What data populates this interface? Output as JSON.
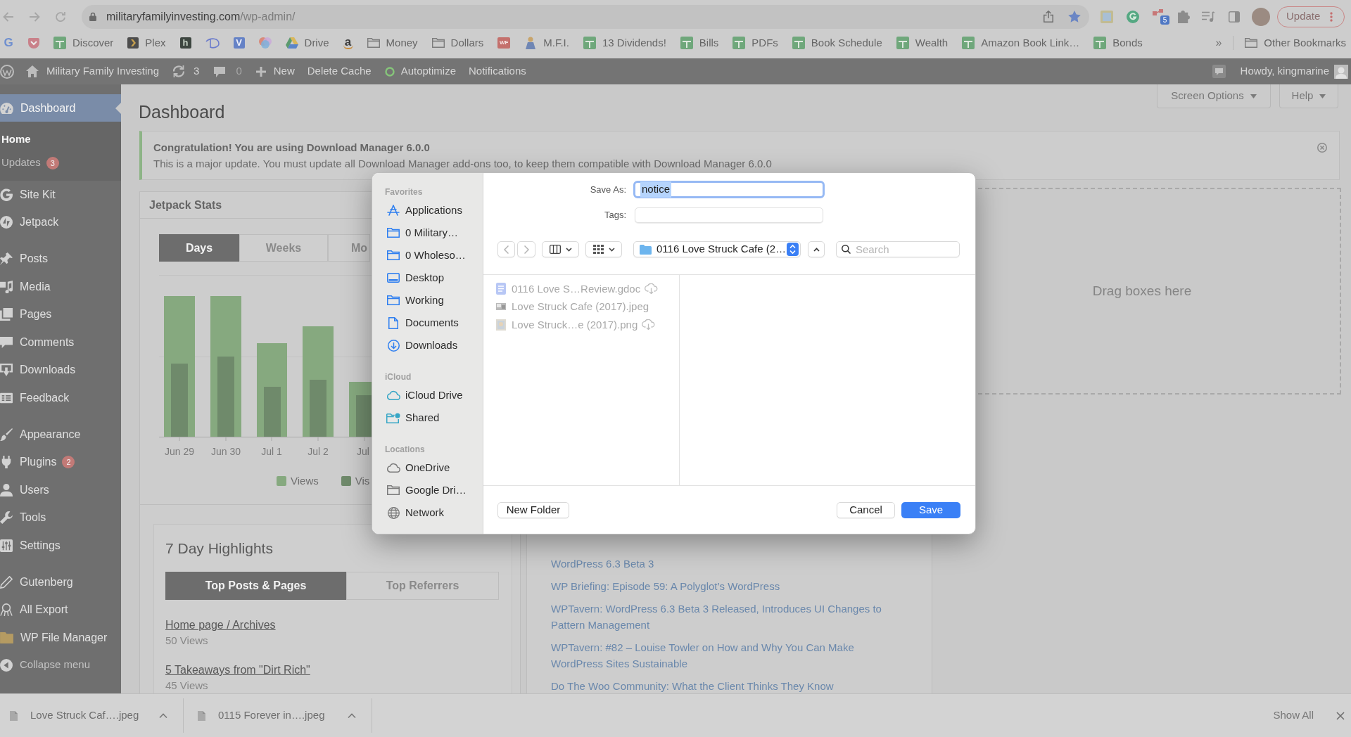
{
  "browser": {
    "url_host": "militaryfamilyinvesting.com",
    "url_path": "/wp-admin/",
    "extension_badge": "5",
    "update_button": "Update"
  },
  "bookmarks": [
    {
      "kind": "google",
      "glyph": "G"
    },
    {
      "kind": "pocket"
    },
    {
      "kind": "sheet",
      "label": "Discover"
    },
    {
      "kind": "plex",
      "label": "Plex"
    },
    {
      "kind": "tile",
      "glyph": "h"
    },
    {
      "kind": "swoosh"
    },
    {
      "kind": "tile_blue",
      "glyph": "V"
    },
    {
      "kind": "pinwheel"
    },
    {
      "kind": "drive",
      "label": "Drive"
    },
    {
      "kind": "amazon",
      "glyph": "a"
    },
    {
      "kind": "folder",
      "label": "Money"
    },
    {
      "kind": "folder",
      "label": "Dollars"
    },
    {
      "kind": "tile_red",
      "glyph": "WF"
    },
    {
      "kind": "figure",
      "label": "M.F.I."
    },
    {
      "kind": "sheet",
      "label": "13 Dividends!"
    },
    {
      "kind": "sheet",
      "label": "Bills"
    },
    {
      "kind": "sheet",
      "label": "PDFs"
    },
    {
      "kind": "sheet",
      "label": "Book Schedule"
    },
    {
      "kind": "sheet",
      "label": "Wealth"
    },
    {
      "kind": "sheet",
      "label": "Amazon Book Link…"
    },
    {
      "kind": "sheet",
      "label": "Bonds"
    }
  ],
  "bookmarks_overflow": "»",
  "other_bookmarks": "Other Bookmarks",
  "admin_bar": {
    "site_name": "Military Family Investing",
    "updates_count": "3",
    "comments_count": "0",
    "new_label": "New",
    "links": [
      {
        "label": "Delete Cache",
        "kind": "plain"
      },
      {
        "label": "Autoptimize",
        "kind": "status"
      },
      {
        "label": "Notifications",
        "kind": "plain"
      }
    ],
    "greeting": "Howdy, kingmarine"
  },
  "sidebar": {
    "groups": [
      {
        "items": [
          {
            "label": "Dashboard",
            "kind": "dashboard",
            "selected": true,
            "children": [
              {
                "label": "Home",
                "selected": true
              },
              {
                "label": "Updates",
                "selected": false,
                "badge": "3"
              }
            ]
          },
          {
            "label": "Site Kit",
            "kind": "sitekit",
            "selected": false
          },
          {
            "label": "Jetpack",
            "kind": "jetpack",
            "selected": false
          }
        ]
      },
      {
        "items": [
          {
            "label": "Posts",
            "kind": "posts",
            "selected": false
          },
          {
            "label": "Media",
            "kind": "media",
            "selected": false
          },
          {
            "label": "Pages",
            "kind": "pages",
            "selected": false
          },
          {
            "label": "Comments",
            "kind": "comments",
            "selected": false
          },
          {
            "label": "Downloads",
            "kind": "downloads",
            "selected": false
          },
          {
            "label": "Feedback",
            "kind": "feedback",
            "selected": false
          }
        ]
      },
      {
        "items": [
          {
            "label": "Appearance",
            "kind": "appearance",
            "selected": false
          },
          {
            "label": "Plugins",
            "kind": "plugins",
            "selected": false,
            "badge": "2"
          },
          {
            "label": "Users",
            "kind": "users",
            "selected": false
          },
          {
            "label": "Tools",
            "kind": "tools",
            "selected": false
          },
          {
            "label": "Settings",
            "kind": "settings",
            "selected": false
          }
        ]
      },
      {
        "items": [
          {
            "label": "Gutenberg",
            "kind": "gutenberg",
            "selected": false
          },
          {
            "label": "All Export",
            "kind": "export",
            "selected": false
          },
          {
            "label": "WP File Manager",
            "kind": "filemanager",
            "selected": false
          }
        ]
      }
    ],
    "collapse_label": "Collapse menu"
  },
  "page": {
    "title": "Dashboard",
    "screen_options": "Screen Options",
    "help": "Help"
  },
  "notice": {
    "title": "Congratulation! You are using Download Manager 6.0.0",
    "text": "This is a major update. You must update all Download Manager add-ons too, to keep them compatible with Download Manager 6.0.0"
  },
  "jetpack_stats": {
    "title": "Jetpack Stats",
    "tabs": [
      {
        "label": "Days",
        "selected": true
      },
      {
        "label": "Weeks",
        "selected": false
      },
      {
        "label": "Mo",
        "selected": false
      }
    ],
    "x_labels": [
      "Jun 29",
      "Jun 30",
      "Jul 1",
      "Jul 2",
      "Jul"
    ],
    "legend": [
      {
        "label": "Views",
        "color": "#86a97f"
      },
      {
        "label": "Vis",
        "color": "#6f8a6b"
      }
    ],
    "highlights": {
      "title": "7 Day Highlights",
      "tabs": [
        {
          "label": "Top Posts & Pages",
          "selected": true
        },
        {
          "label": "Top Referrers",
          "selected": false
        }
      ],
      "posts": [
        {
          "title": "Home page / Archives",
          "views": "50 Views"
        },
        {
          "title": "5 Takeaways from \"Dirt Rich\"",
          "views": "45 Views"
        }
      ]
    }
  },
  "news": {
    "items": [
      "WordPress 6.3 Beta 3",
      "WP Briefing: Episode 59: A Polyglot’s WordPress",
      "WPTavern: WordPress 6.3 Beta 3 Released, Introduces UI Changes to Pattern Management",
      "WPTavern: #82 – Louise Towler on How and Why You Can Make WordPress Sites Sustainable",
      "Do The Woo Community: What the Client Thinks They Know"
    ]
  },
  "drop_zone": {
    "text": "Drag boxes here"
  },
  "downloads_bar": {
    "items": [
      {
        "name": "Love Struck Caf….jpeg"
      },
      {
        "name": "0115 Forever in….jpeg"
      }
    ],
    "show_all": "Show All"
  },
  "save_dialog": {
    "sidebar": [
      {
        "header": "Favorites",
        "items": [
          {
            "label": "Applications",
            "kind": "apps"
          },
          {
            "label": "0 Military…",
            "kind": "folder"
          },
          {
            "label": "0 Wholeso…",
            "kind": "folder"
          },
          {
            "label": "Desktop",
            "kind": "desktop"
          },
          {
            "label": "Working",
            "kind": "folder"
          },
          {
            "label": "Documents",
            "kind": "document"
          },
          {
            "label": "Downloads",
            "kind": "download"
          }
        ]
      },
      {
        "header": "iCloud",
        "items": [
          {
            "label": "iCloud Drive",
            "kind": "icloud"
          },
          {
            "label": "Shared",
            "kind": "shared"
          }
        ]
      },
      {
        "header": "Locations",
        "items": [
          {
            "label": "OneDrive",
            "kind": "cloud"
          },
          {
            "label": "Google Dri…",
            "kind": "drive"
          },
          {
            "label": "Network",
            "kind": "network"
          }
        ]
      }
    ],
    "save_as_label": "Save As:",
    "filename": "notice",
    "filename_selected": true,
    "tags_label": "Tags:",
    "location": "0116 Love Struck Cafe (2…",
    "search": {
      "placeholder": "Search"
    },
    "files": [
      {
        "name": "0116 Love S…Review.gdoc",
        "kind": "gdoc",
        "in_cloud": true,
        "disabled": true
      },
      {
        "name": "Love Struck Cafe (2017).jpeg",
        "kind": "jpeg",
        "in_cloud": false,
        "disabled": true
      },
      {
        "name": "Love Struck…e (2017).png",
        "kind": "png",
        "in_cloud": true,
        "disabled": true
      }
    ],
    "new_folder": "New Folder",
    "cancel": "Cancel",
    "save": "Save"
  }
}
